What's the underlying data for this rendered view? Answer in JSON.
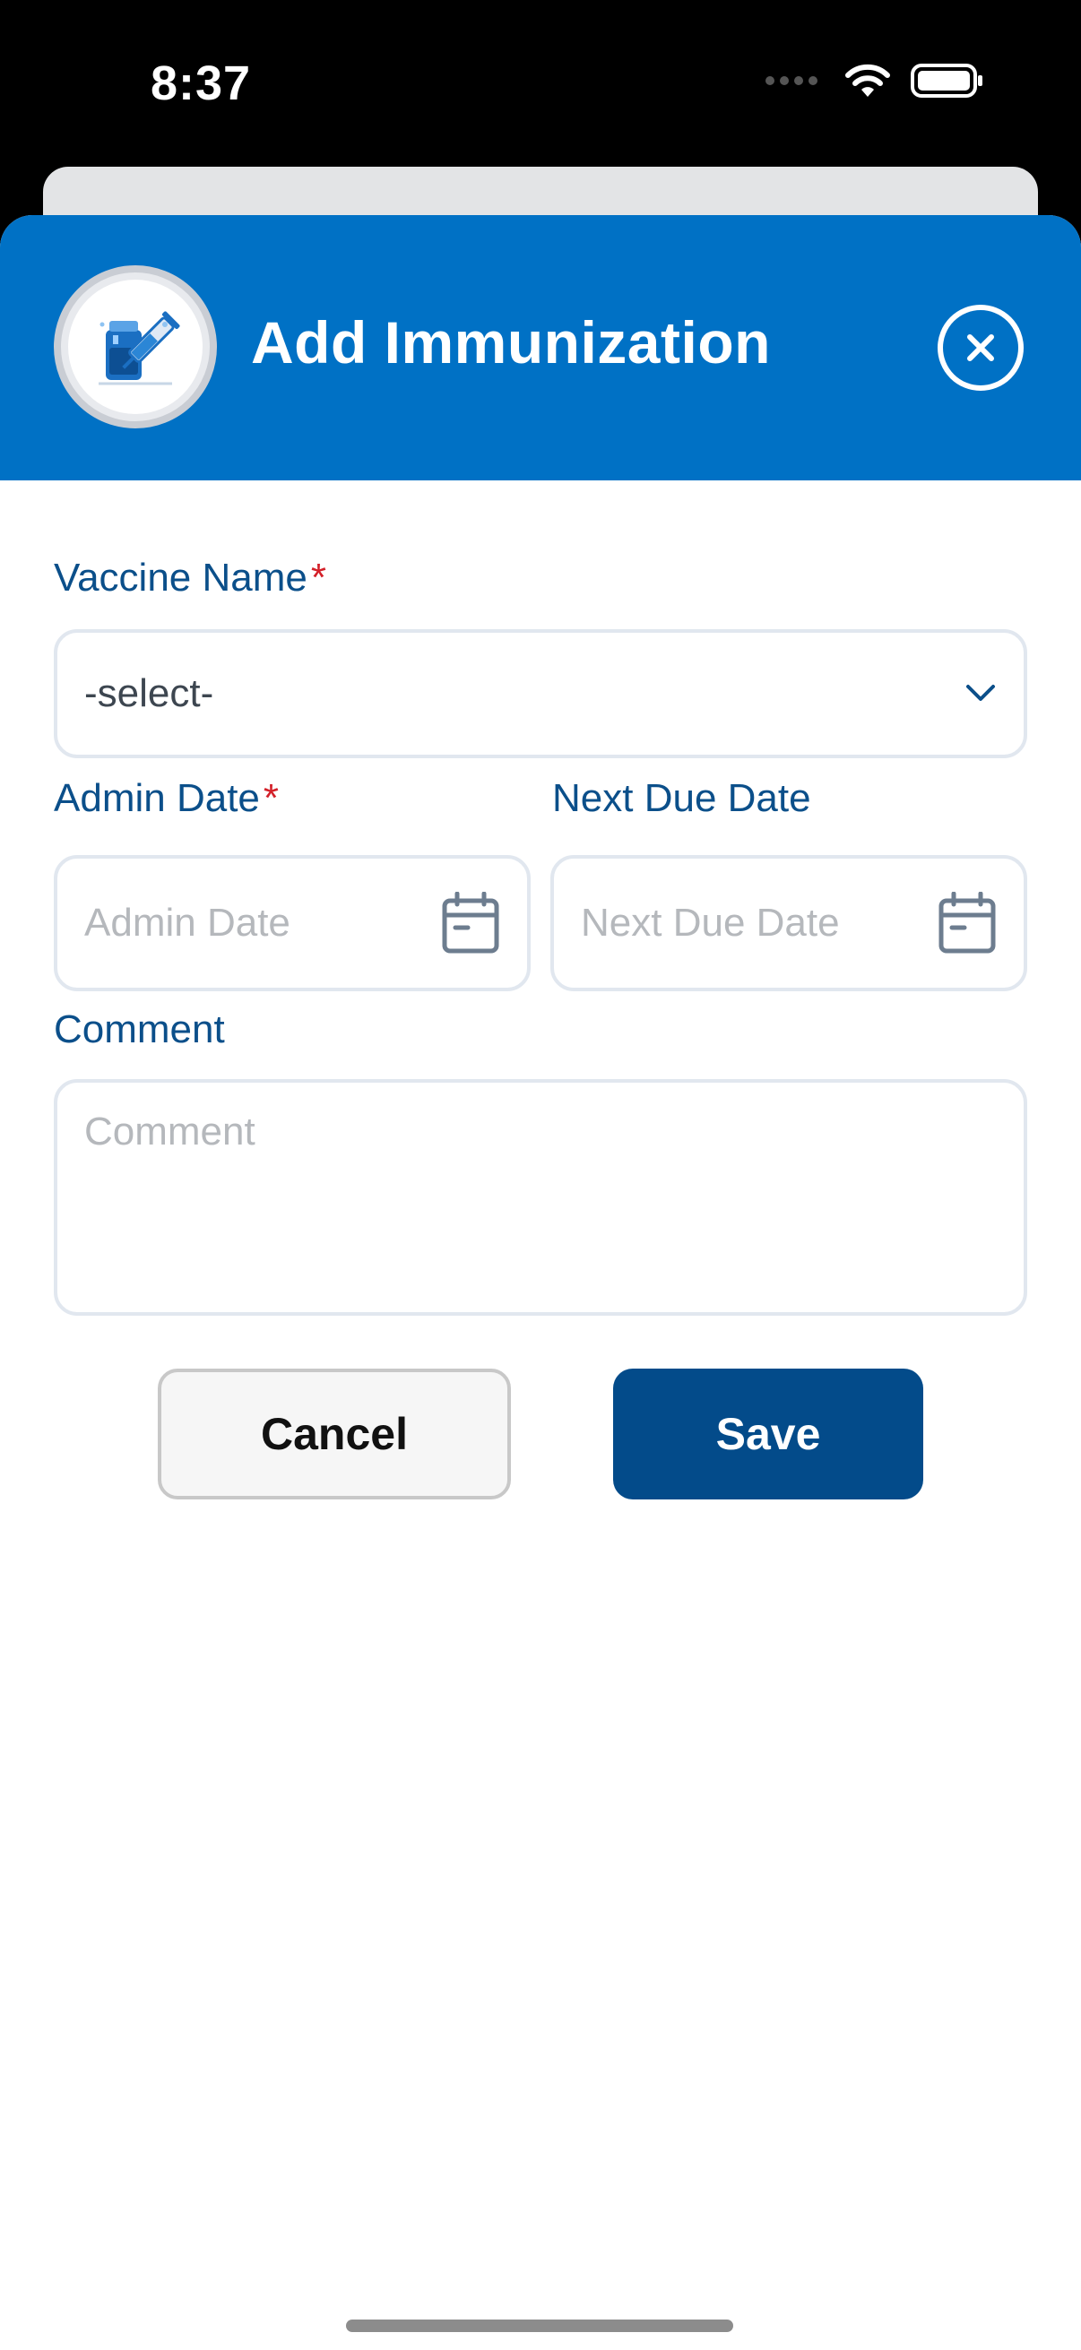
{
  "status_bar": {
    "time": "8:37"
  },
  "header": {
    "title": "Add Immunization",
    "icon": "vaccine-icon",
    "color": "#0071c5"
  },
  "form": {
    "vaccine_name": {
      "label": "Vaccine Name",
      "required": "*",
      "value": "-select-"
    },
    "admin_date": {
      "label": "Admin Date",
      "required": "*",
      "placeholder": "Admin Date"
    },
    "next_due_date": {
      "label": "Next Due Date",
      "placeholder": "Next Due Date"
    },
    "comment": {
      "label": "Comment",
      "placeholder": "Comment"
    }
  },
  "actions": {
    "cancel_label": "Cancel",
    "save_label": "Save",
    "save_color": "#034b8a"
  }
}
